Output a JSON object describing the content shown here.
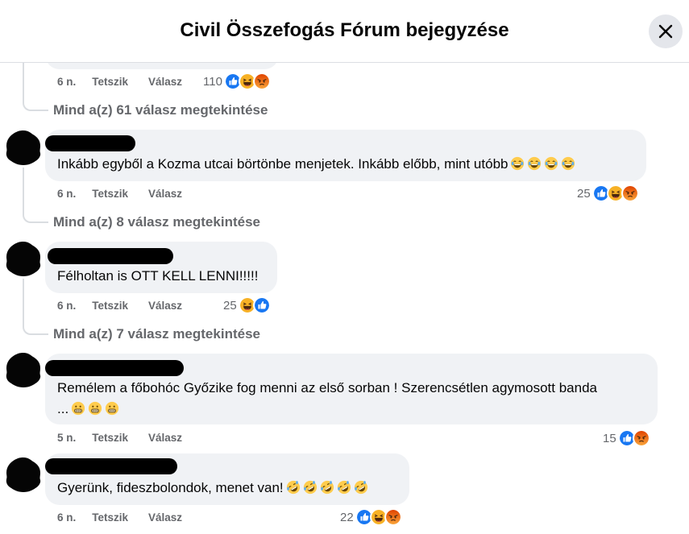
{
  "header": {
    "title": "Civil Összefogás Fórum bejegyzése",
    "close_icon": "close-icon"
  },
  "colors": {
    "bubble": "#f0f2f5",
    "muted_text": "#65676b",
    "like_blue": "#1877f2",
    "haha_yellow": "#f7b125",
    "angry_orange": "#e9710f"
  },
  "previous_comment": {
    "time": "6 n.",
    "like_label": "Tetszik",
    "reply_label": "Válasz",
    "reaction_count": "110",
    "reactions": [
      "like-icon",
      "haha-icon",
      "angry-icon"
    ],
    "more_replies": "Mind a(z) 61 válasz megtekintése"
  },
  "comments": [
    {
      "text": "Inkább egyből a Kozma utcai börtönbe menjetek. Inkább előbb, mint utóbb",
      "emojis": [
        "laugh-cry-emoji",
        "laugh-cry-emoji",
        "laugh-cry-emoji",
        "laugh-cry-emoji"
      ],
      "time": "6 n.",
      "like_label": "Tetszik",
      "reply_label": "Válasz",
      "reaction_count": "25",
      "reactions": [
        "like-icon",
        "haha-icon",
        "angry-icon"
      ],
      "more_replies": "Mind a(z) 8 válasz megtekintése"
    },
    {
      "text": "Félholtan is OTT KELL LENNI!!!!!",
      "emojis": [],
      "time": "6 n.",
      "like_label": "Tetszik",
      "reply_label": "Válasz",
      "reaction_count": "25",
      "reactions": [
        "haha-icon",
        "like-icon"
      ],
      "more_replies": "Mind a(z) 7 válasz megtekintése"
    },
    {
      "text_line1": "Remélem a főbohóc Győzike fog menni az első sorban ! Szerencsétlen agymosott banda",
      "text_line2": "...",
      "emojis": [
        "grimace-emoji",
        "grimace-emoji",
        "grimace-emoji"
      ],
      "time": "5 n.",
      "like_label": "Tetszik",
      "reply_label": "Válasz",
      "reaction_count": "15",
      "reactions": [
        "like-icon",
        "angry-icon"
      ]
    },
    {
      "text": "Gyerünk, fideszbolondok, menet van!",
      "emojis": [
        "rofl-emoji",
        "rofl-emoji",
        "rofl-emoji",
        "rofl-emoji",
        "rofl-emoji"
      ],
      "time": "6 n.",
      "like_label": "Tetszik",
      "reply_label": "Válasz",
      "reaction_count": "22",
      "reactions": [
        "like-icon",
        "haha-icon",
        "angry-icon"
      ]
    }
  ]
}
